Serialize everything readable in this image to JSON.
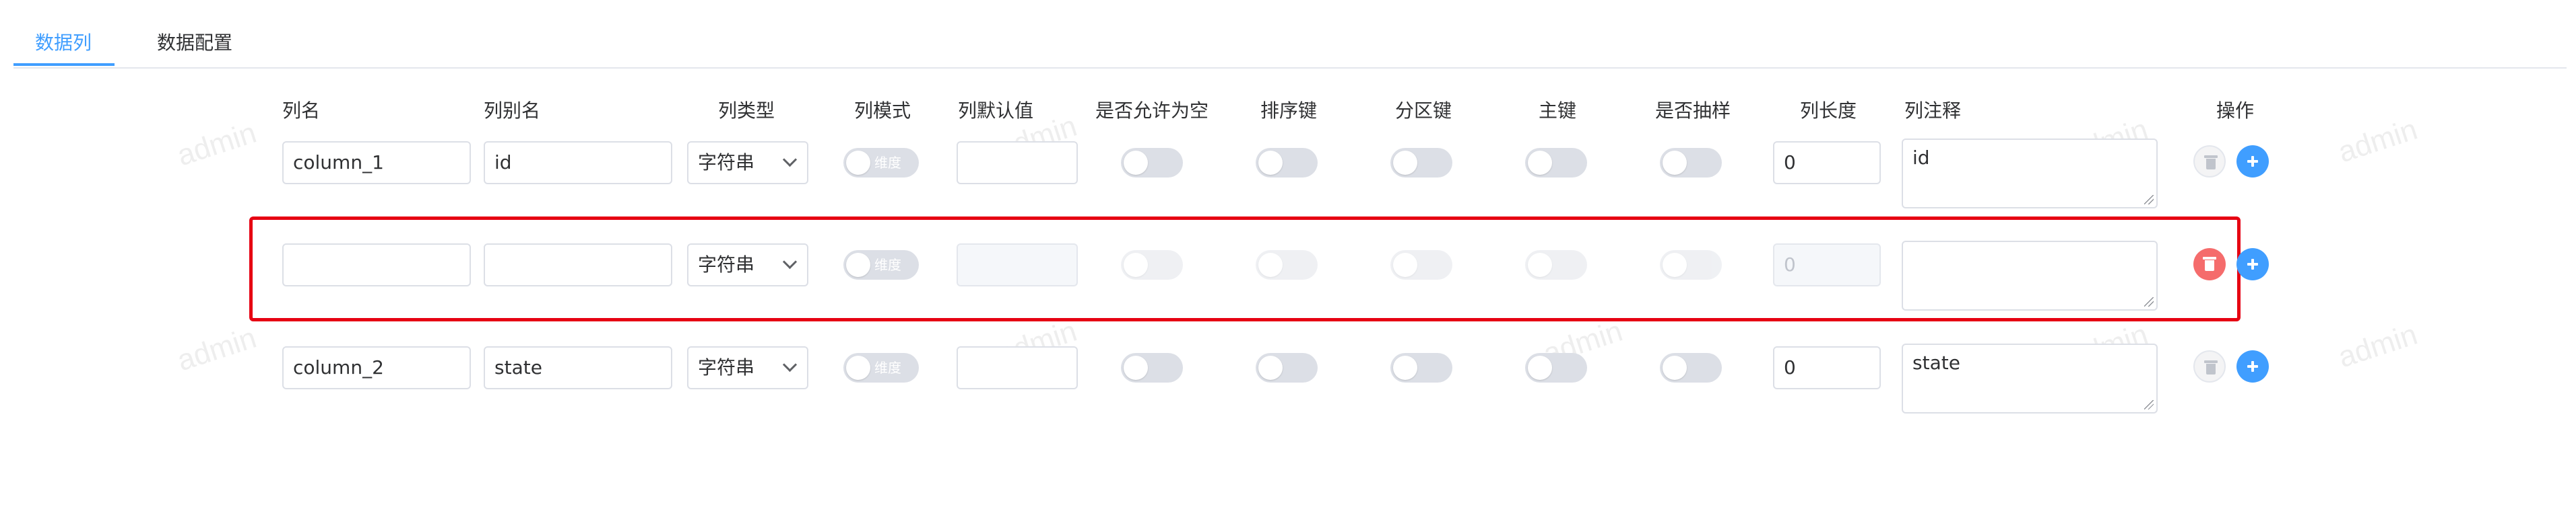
{
  "tabs": [
    {
      "label": "数据列",
      "active": true
    },
    {
      "label": "数据配置",
      "active": false
    }
  ],
  "watermark": "admin",
  "columns": [
    "列名",
    "列别名",
    "列类型",
    "列模式",
    "列默认值",
    "是否允许为空",
    "排序键",
    "分区键",
    "主键",
    "是否抽样",
    "列长度",
    "列注释",
    "操作"
  ],
  "rows": [
    {
      "name": "column_1",
      "alias": "id",
      "type": "字符串",
      "mode": "维度",
      "default": "",
      "nullable": false,
      "sort_key": false,
      "partition_key": false,
      "primary_key": false,
      "sample": false,
      "length": "0",
      "comment": "id",
      "delete_enabled": false,
      "disabled": false
    },
    {
      "name": "",
      "alias": "",
      "type": "字符串",
      "mode": "维度",
      "default": "",
      "nullable": false,
      "sort_key": false,
      "partition_key": false,
      "primary_key": false,
      "sample": false,
      "length": "0",
      "comment": "",
      "delete_enabled": true,
      "disabled": true,
      "highlighted": true
    },
    {
      "name": "column_2",
      "alias": "state",
      "type": "字符串",
      "mode": "维度",
      "default": "",
      "nullable": false,
      "sort_key": false,
      "partition_key": false,
      "primary_key": false,
      "sample": false,
      "length": "0",
      "comment": "state",
      "delete_enabled": false,
      "disabled": false
    }
  ],
  "colors": {
    "accent": "#409eff",
    "danger": "#f56c6c",
    "highlight_border": "#e60012",
    "switch_off": "#dcdfe6"
  },
  "icons": [
    "trash-icon",
    "plus-icon",
    "chevron-down-icon",
    "resize-grip-icon"
  ]
}
